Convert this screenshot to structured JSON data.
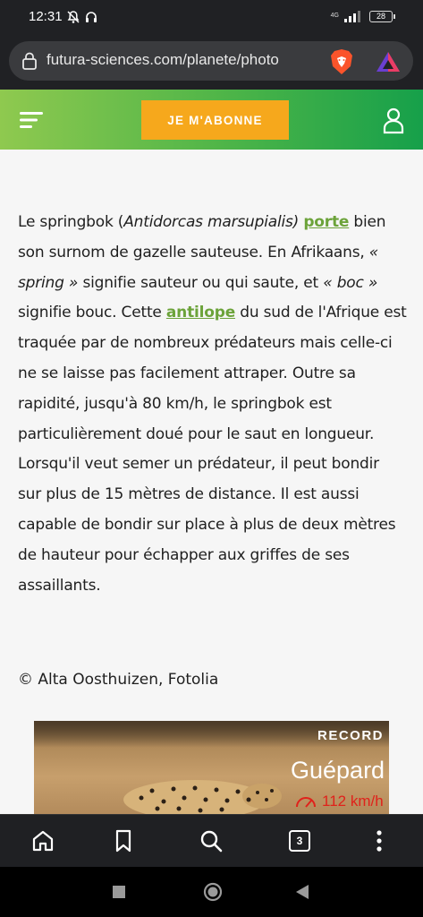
{
  "status_bar": {
    "time": "12:31",
    "network": "4G",
    "battery": "28"
  },
  "browser": {
    "url": "futura-sciences.com/planete/photo"
  },
  "header": {
    "subscribe_label": "JE M'ABONNE"
  },
  "article": {
    "p1_a": "Le springbok (",
    "p1_italic": "Antidorcas marsupialis)",
    "p1_link1": "porte",
    "p1_b": " bien son surnom de gazelle sauteuse. En Afrikaans, ",
    "p1_spring": "« spring »",
    "p1_c": " signifie sauteur ou qui saute, et ",
    "p1_boc": "« boc »",
    "p1_d": " signifie bouc. Cette ",
    "p1_link2": "antilope",
    "p1_e": " du sud de l'Afrique est traquée par de nombreux prédateurs mais celle-ci ne se laisse pas facilement attraper. Outre sa rapidité, jusqu'à 80 km/h, le springbok est particulièrement doué pour le saut en longueur. Lorsqu'il veut semer un prédateur, il peut bondir sur plus de 15 mètres de distance. Il est aussi capable de bondir sur place à plus de deux mètres de hauteur pour échapper aux griffes de ses assaillants.",
    "credit": "© Alta Oosthuizen, Fotolia"
  },
  "photo_card": {
    "banner": "RECORD",
    "animal": "Guépard",
    "speed": "112 km/h"
  },
  "bottom_nav": {
    "tab_count": "3"
  },
  "colors": {
    "link": "#6ca33a",
    "subscribe": "#f6a81c",
    "header_start": "#8fc94f",
    "header_end": "#16a04a"
  }
}
